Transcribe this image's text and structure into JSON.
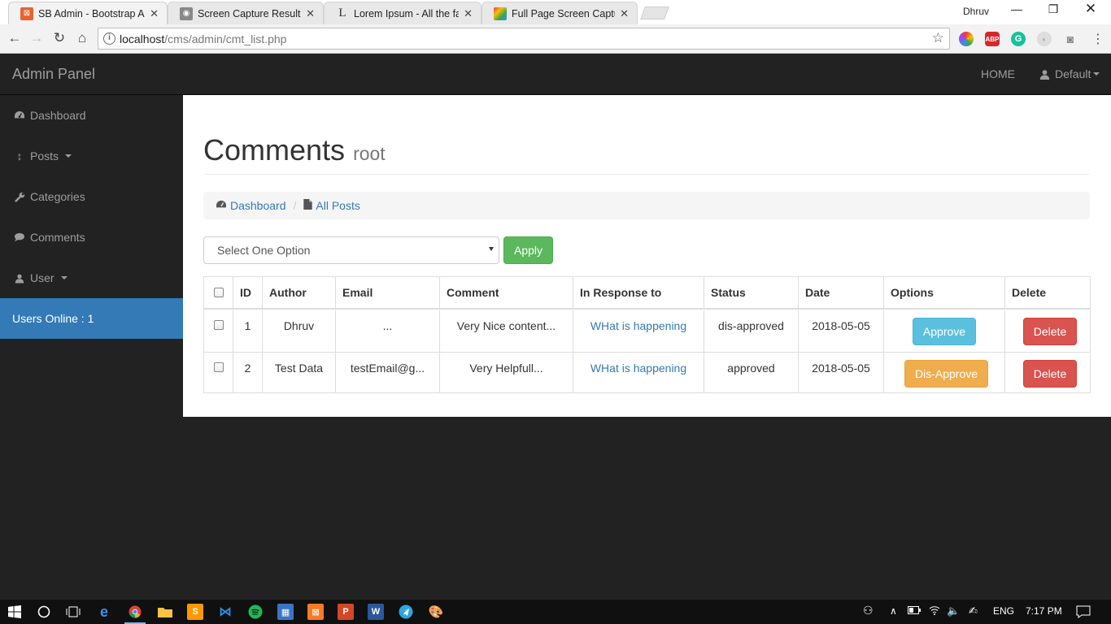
{
  "browser": {
    "tabs": [
      {
        "title": "SB Admin - Bootstrap Ad",
        "active": true
      },
      {
        "title": "Screen Capture Result",
        "active": false
      },
      {
        "title": "Lorem Ipsum - All the fac",
        "active": false
      },
      {
        "title": "Full Page Screen Capture",
        "active": false
      }
    ],
    "profile_name": "Dhruv",
    "url_host": "localhost",
    "url_path": "/cms/admin/cmt_list.php",
    "extensions": [
      "color-picker",
      "ABP",
      "grammarly",
      "extension",
      "camera"
    ]
  },
  "navbar": {
    "brand": "Admin Panel",
    "home": "HOME",
    "user": "Default"
  },
  "sidebar": {
    "items": [
      {
        "label": "Dashboard",
        "icon": "dashboard-icon"
      },
      {
        "label": "Posts",
        "icon": "arrows-v-icon"
      },
      {
        "label": "Categories",
        "icon": "wrench-icon"
      },
      {
        "label": "Comments",
        "icon": "comment-icon"
      },
      {
        "label": "User",
        "icon": "user-icon"
      }
    ],
    "users_online": "Users Online : 1"
  },
  "main": {
    "title": "Comments",
    "subtitle": "root",
    "breadcrumb": [
      "Dashboard",
      "All Posts"
    ],
    "bulk_select": "Select One Option",
    "apply_label": "Apply",
    "table": {
      "headers": [
        "ID",
        "Author",
        "Email",
        "Comment",
        "In Response to",
        "Status",
        "Date",
        "Options",
        "Delete"
      ],
      "rows": [
        {
          "id": "1",
          "author": "Dhruv",
          "email": "...",
          "comment": "Very Nice content...",
          "response": "WHat is happening",
          "status": "dis-approved",
          "date": "2018-05-05",
          "option": "Approve",
          "delete": "Delete"
        },
        {
          "id": "2",
          "author": "Test Data",
          "email": "testEmail@g...",
          "comment": "Very Helpfull...",
          "response": "WHat is happening",
          "status": "approved",
          "date": "2018-05-05",
          "option": "Dis-Approve",
          "delete": "Delete"
        }
      ]
    }
  },
  "taskbar": {
    "language": "ENG",
    "time": "7:17 PM"
  },
  "colors": {
    "primary": "#337ab7",
    "success": "#5cb85c",
    "info": "#5bc0de",
    "warning": "#f0ad4e",
    "danger": "#d9534f",
    "navbar": "#222222"
  }
}
